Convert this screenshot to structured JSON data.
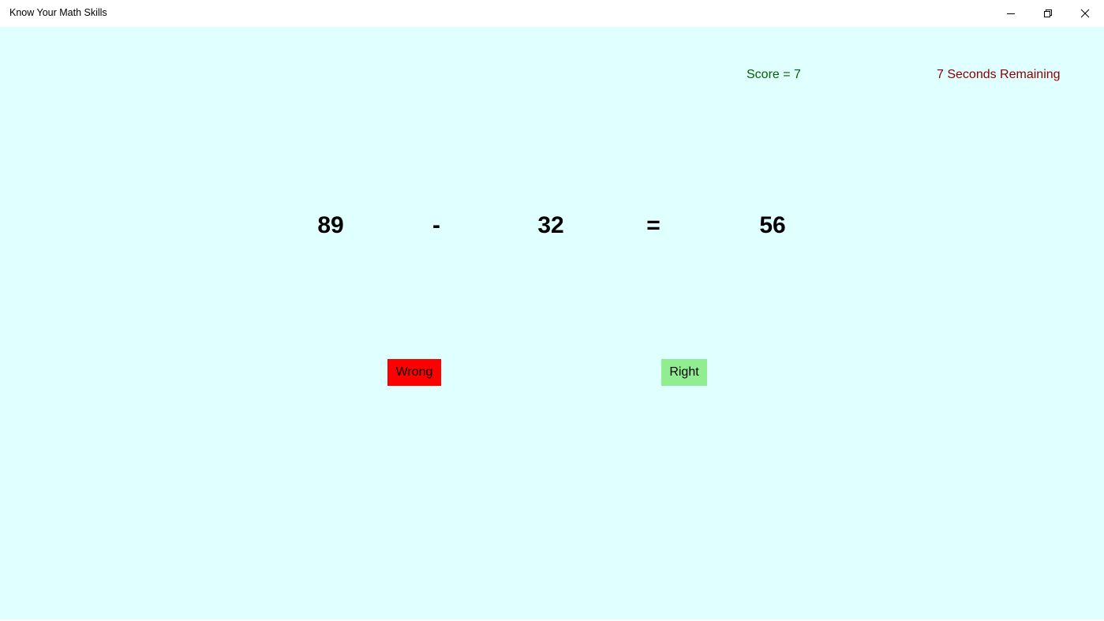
{
  "window": {
    "title": "Know Your Math Skills",
    "controls": {
      "minimize_icon": "minimize-icon",
      "restore_icon": "restore-icon",
      "close_icon": "close-icon"
    }
  },
  "status": {
    "score": "Score = 7",
    "timer": "7 Seconds Remaining",
    "score_color": "#006400",
    "timer_color": "#8b0000"
  },
  "equation": {
    "operand1": "89",
    "operator": "-",
    "operand2": "32",
    "equals": "=",
    "result": "56"
  },
  "buttons": {
    "wrong_label": "Wrong",
    "right_label": "Right",
    "wrong_color": "#ff0000",
    "right_color": "#90ee90"
  },
  "colors": {
    "background": "#e0ffff"
  }
}
